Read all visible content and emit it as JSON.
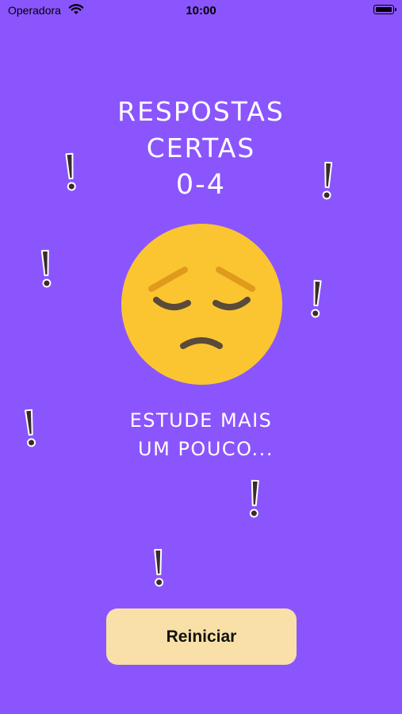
{
  "status_bar": {
    "carrier": "Operadora",
    "time": "10:00"
  },
  "result": {
    "title_line1": "RESPOSTAS",
    "title_line2": "CERTAS",
    "score": "0-4",
    "message_line1": "ESTUDE MAIS",
    "message_line2": "UM POUCO...",
    "emoji_icon": "pensive-face-icon"
  },
  "restart_label": "Reiniciar",
  "colors": {
    "background": "#8b55fd",
    "button": "#f8e0a8",
    "emoji": "#fbc531",
    "features": "#5a4a3a"
  },
  "decoration_icon": "exclamation-icon"
}
